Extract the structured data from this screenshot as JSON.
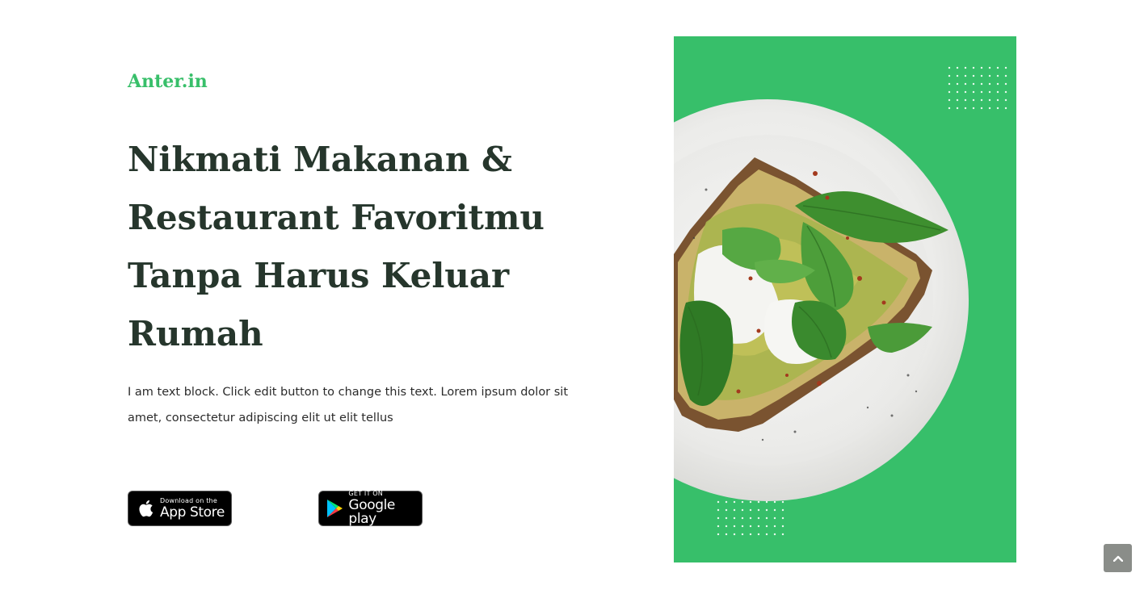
{
  "brand": {
    "name": "Anter.in",
    "color": "#38bf6a"
  },
  "hero": {
    "headline_lines": [
      "Nikmati Makanan &",
      "Restaurant Favoritmu",
      "Tanpa Harus Keluar",
      "Rumah"
    ],
    "description": "I am text block. Click edit button to change this text. Lorem ipsum dolor sit amet, consectetur adipiscing elit ut elit tellus",
    "panel_color": "#37bf6a"
  },
  "badges": {
    "app_store": {
      "small": "Download on the",
      "big": "App Store",
      "icon": "apple-icon"
    },
    "google_play": {
      "small": "GET IT ON",
      "big": "Google play",
      "icon": "google-play-icon"
    }
  },
  "scroll_top": {
    "icon": "chevron-up-icon"
  }
}
